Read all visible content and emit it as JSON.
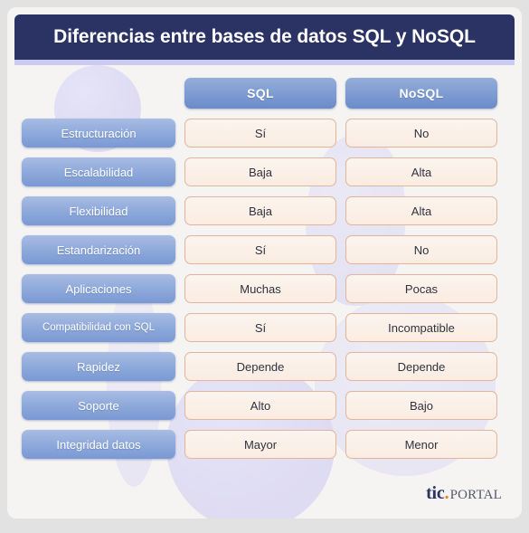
{
  "header": {
    "title": "Diferencias entre bases de datos SQL y NoSQL"
  },
  "table": {
    "columns": [
      "SQL",
      "NoSQL"
    ],
    "rows": [
      {
        "label": "Estructuración",
        "sql": "Sí",
        "nosql": "No"
      },
      {
        "label": "Escalabilidad",
        "sql": "Baja",
        "nosql": "Alta"
      },
      {
        "label": "Flexibilidad",
        "sql": "Baja",
        "nosql": "Alta"
      },
      {
        "label": "Estandarización",
        "sql": "Sí",
        "nosql": "No"
      },
      {
        "label": "Aplicaciones",
        "sql": "Muchas",
        "nosql": "Pocas"
      },
      {
        "label": "Compatibilidad con SQL",
        "sql": "Sí",
        "nosql": "Incompatible"
      },
      {
        "label": "Rapidez",
        "sql": "Depende",
        "nosql": "Depende"
      },
      {
        "label": "Soporte",
        "sql": "Alto",
        "nosql": "Bajo"
      },
      {
        "label": "Integridad datos",
        "sql": "Mayor",
        "nosql": "Menor"
      }
    ]
  },
  "footer": {
    "logo_primary": "tic",
    "logo_dot": ".",
    "logo_secondary": "PORTAL"
  },
  "colors": {
    "header_bg": "#2b3264",
    "header_underline": "#ccccf0",
    "label_blue": "#8faadb",
    "value_peach": "#fbece1",
    "value_border": "#e0b49d",
    "page_bg": "#e2e2e2",
    "card_bg": "#f5f4f3",
    "logo_orange": "#e8821e"
  }
}
